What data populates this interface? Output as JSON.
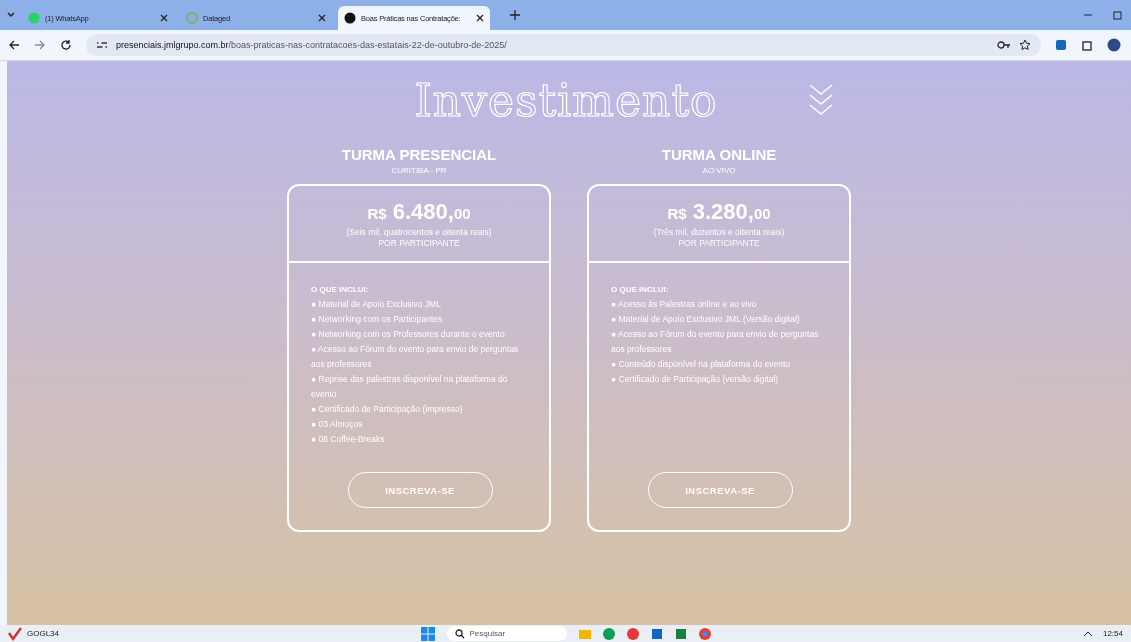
{
  "browser": {
    "tabs": [
      {
        "title": "(1) WhatsApp",
        "kind": "whatsapp",
        "selected": false
      },
      {
        "title": "Dataged",
        "kind": "datagd",
        "selected": false
      },
      {
        "title": "Boas Práticas nas Contrataçõe:",
        "kind": "site",
        "selected": true
      }
    ],
    "url_domain": "presenciais.jmlgrupo.com.br",
    "url_path": "/boas-praticas-nas-contratacoes-das-estatais-22-de-outubro-de-2025/"
  },
  "page": {
    "title": "Investimento",
    "plans": [
      {
        "name": "TURMA PRESENCIAL",
        "subtitle": "CURITIBA - PR",
        "currency": "R$",
        "price": "6.480,",
        "cents": "00",
        "price_words": "(Seis mil, quatrocentos e oitenta reais)",
        "per": "POR PARTICIPANTE",
        "includes_title": "O QUE INCLUI:",
        "items": [
          "● Material de Apoio Exclusivo JML",
          "● Networking com os Participantes",
          "● Networking com os Professores durante o evento",
          "● Acesso ao Fórum do evento para envio de perguntas aos professores",
          "● Reprise das palestras disponível na plataforma do evento",
          "● Certificado de Participação (impresso)",
          "● 03 Almoços",
          "● 06 Coffee-Breaks"
        ],
        "button": "INSCREVA-SE"
      },
      {
        "name": "TURMA ONLINE",
        "subtitle": "AO VIVO",
        "currency": "R$",
        "price": "3.280,",
        "cents": "00",
        "price_words": "(Três mil, duzentos e oitenta reais)",
        "per": "POR PARTICIPANTE",
        "includes_title": "O QUE INCLUI:",
        "items": [
          "● Acesso às Palestras online e ao vivo",
          "● Material de Apoio Exclusivo JML (Versão digital)",
          "● Acesso ao Fórum do evento para envio de perguntas aos professores",
          "● Conteúdo disponível na plataforma do evento",
          "● Certificado de Participação (versão digital)"
        ],
        "button": "INSCREVA-SE"
      }
    ]
  },
  "taskbar": {
    "stock": "GOGL34",
    "search_placeholder": "Pesquisar",
    "time": "12:54"
  }
}
